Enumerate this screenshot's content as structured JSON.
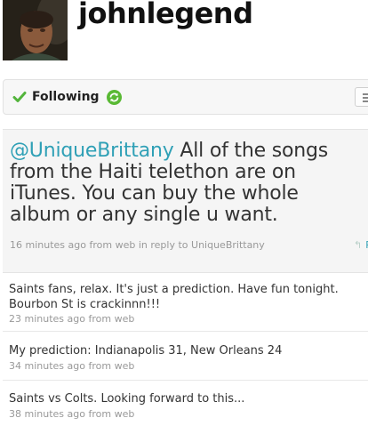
{
  "profile": {
    "username": "johnlegend",
    "avatar_alt": "profile photo"
  },
  "follow_bar": {
    "following_label": "Following",
    "check_icon": "check-icon",
    "refresh_icon": "refresh-icon",
    "list_icon": "list-icon"
  },
  "featured_tweet": {
    "mention": "@UniqueBrittany",
    "text": " All of the songs from the Haiti telethon are on iTunes. You can buy the whole album or any single u want.",
    "time": "16 minutes ago",
    "source_prefix": "from",
    "source": "web",
    "reply_prefix": "in reply to",
    "reply_to": "UniqueBrittany",
    "reply_label": "R"
  },
  "tweets": [
    {
      "text": "Saints fans, relax. It's just a prediction. Have fun tonight. Bourbon St is crackinnn!!!",
      "time": "23 minutes ago",
      "source_prefix": "from",
      "source": "web"
    },
    {
      "text": "My prediction: Indianapolis 31, New Orleans 24",
      "time": "34 minutes ago",
      "source_prefix": "from",
      "source": "web"
    },
    {
      "text": "Saints vs Colts. Looking forward to this...",
      "time": "38 minutes ago",
      "source_prefix": "from",
      "source": "web"
    }
  ],
  "colors": {
    "accent": "#2fa0b6",
    "check": "#53b43c",
    "refresh": "#59b934"
  }
}
